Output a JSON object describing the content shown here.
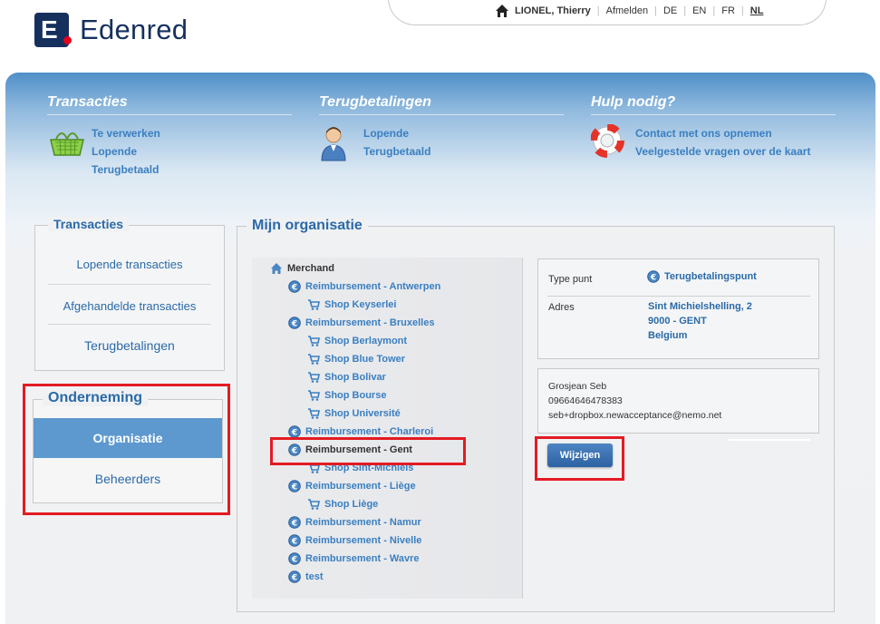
{
  "brand": {
    "name": "Edenred",
    "logo_letter": "E"
  },
  "userbar": {
    "user": "LIONEL, Thierry",
    "logout": "Afmelden",
    "languages": [
      "DE",
      "EN",
      "FR",
      "NL"
    ],
    "active_language": "NL"
  },
  "nav": {
    "transacties": {
      "title": "Transacties",
      "icon": "basket-icon",
      "links": [
        "Te verwerken",
        "Lopende",
        "Terugbetaald"
      ]
    },
    "terugbetalingen": {
      "title": "Terugbetalingen",
      "icon": "person-icon",
      "links": [
        "Lopende",
        "Terugbetaald"
      ]
    },
    "hulp": {
      "title": "Hulp nodig?",
      "icon": "lifebuoy-icon",
      "links": [
        "Contact met ons opnemen",
        "Veelgestelde vragen over de kaart"
      ]
    }
  },
  "sidebar": {
    "transacties": {
      "title": "Transacties",
      "items": [
        "Lopende transacties",
        "Afgehandelde transacties",
        "Terugbetalingen"
      ]
    },
    "onderneming": {
      "title": "Onderneming",
      "active": "Organisatie",
      "items": [
        "Beheerders"
      ]
    }
  },
  "main": {
    "title": "Mijn organisatie",
    "tree": [
      {
        "label": "Merchand",
        "level": 0,
        "icon": "home-icon"
      },
      {
        "label": "Reimbursement - Antwerpen",
        "level": 1,
        "icon": "euro-icon"
      },
      {
        "label": "Shop Keyserlei",
        "level": 2,
        "icon": "cart-icon"
      },
      {
        "label": "Reimbursement - Bruxelles",
        "level": 1,
        "icon": "euro-icon"
      },
      {
        "label": "Shop Berlaymont",
        "level": 2,
        "icon": "cart-icon"
      },
      {
        "label": "Shop Blue Tower",
        "level": 2,
        "icon": "cart-icon"
      },
      {
        "label": "Shop Bolivar",
        "level": 2,
        "icon": "cart-icon"
      },
      {
        "label": "Shop Bourse",
        "level": 2,
        "icon": "cart-icon"
      },
      {
        "label": "Shop Université",
        "level": 2,
        "icon": "cart-icon"
      },
      {
        "label": "Reimbursement - Charleroi",
        "level": 1,
        "icon": "euro-icon"
      },
      {
        "label": "Reimbursement - Gent",
        "level": 1,
        "icon": "euro-icon",
        "selected": true
      },
      {
        "label": "Shop Sint-Michiels",
        "level": 2,
        "icon": "cart-icon"
      },
      {
        "label": "Reimbursement - Liège",
        "level": 1,
        "icon": "euro-icon"
      },
      {
        "label": "Shop Liège",
        "level": 2,
        "icon": "cart-icon"
      },
      {
        "label": "Reimbursement - Namur",
        "level": 1,
        "icon": "euro-icon"
      },
      {
        "label": "Reimbursement - Nivelle",
        "level": 1,
        "icon": "euro-icon"
      },
      {
        "label": "Reimbursement - Wavre",
        "level": 1,
        "icon": "euro-icon"
      },
      {
        "label": "test",
        "level": 1,
        "icon": "euro-icon"
      }
    ],
    "details": {
      "type_label": "Type punt",
      "type_value": "Terugbetalingspunt",
      "address_label": "Adres",
      "address_lines": [
        "Sint Michielshelling, 2",
        "9000 - GENT",
        "Belgium"
      ]
    },
    "contact": {
      "name": "Grosjean Seb",
      "phone": "09664646478383",
      "email": "seb+dropbox.newacceptance@nemo.net"
    },
    "edit_button": "Wijzigen"
  },
  "colors": {
    "accent": "#2a6aa8",
    "active_bg": "#5d98cf",
    "highlight": "#e31b23",
    "brand": "#16305e"
  }
}
